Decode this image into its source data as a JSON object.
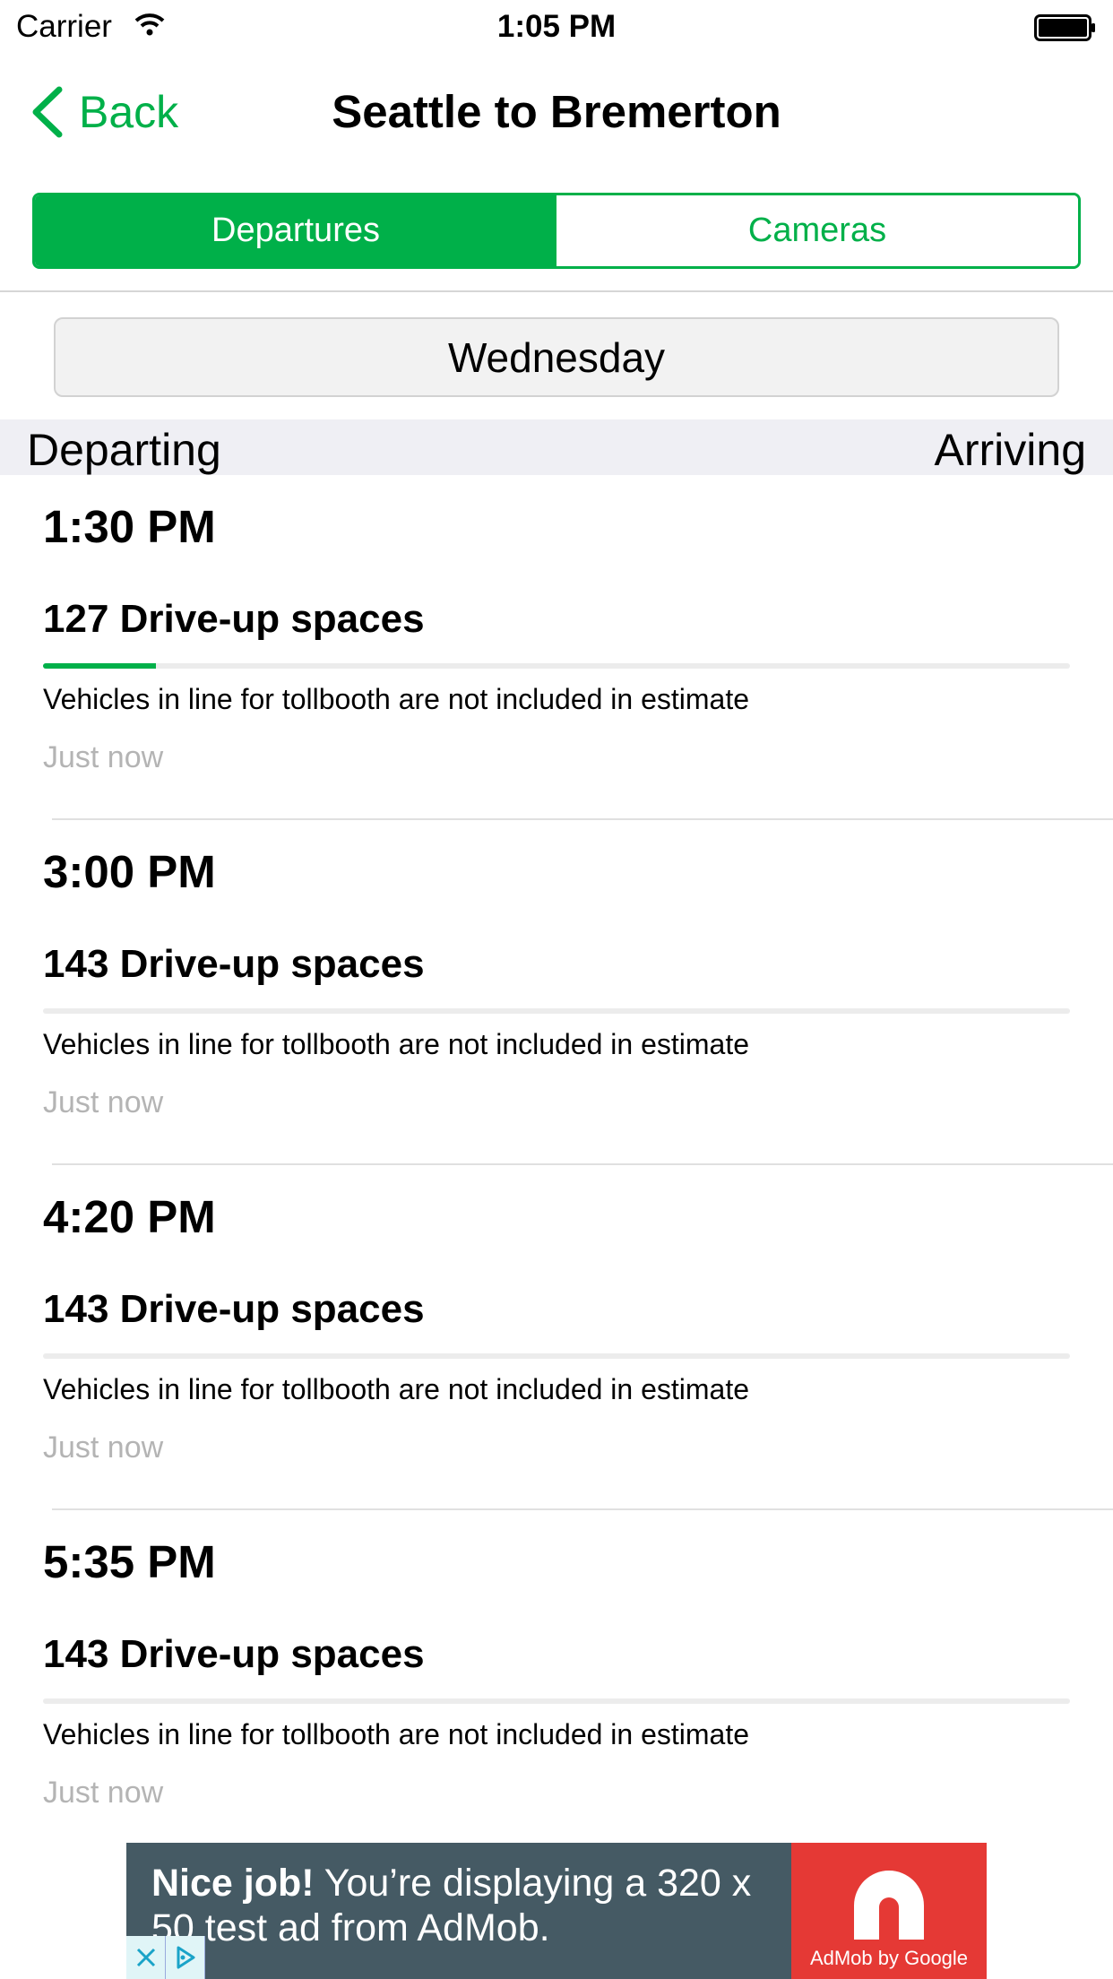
{
  "status_bar": {
    "carrier": "Carrier",
    "time": "1:05 PM"
  },
  "nav": {
    "back_label": "Back",
    "title": "Seattle to Bremerton"
  },
  "segments": {
    "departures": "Departures",
    "cameras": "Cameras"
  },
  "day": "Wednesday",
  "list_header": {
    "departing": "Departing",
    "arriving": "Arriving"
  },
  "sailings": [
    {
      "time": "1:30 PM",
      "spaces": "127 Drive-up spaces",
      "fill_percent": 11,
      "note": "Vehicles in line for tollbooth are not included in estimate",
      "updated": "Just now"
    },
    {
      "time": "3:00 PM",
      "spaces": "143 Drive-up spaces",
      "fill_percent": 0,
      "note": "Vehicles in line for tollbooth are not included in estimate",
      "updated": "Just now"
    },
    {
      "time": "4:20 PM",
      "spaces": "143 Drive-up spaces",
      "fill_percent": 0,
      "note": "Vehicles in line for tollbooth are not included in estimate",
      "updated": "Just now"
    },
    {
      "time": "5:35 PM",
      "spaces": "143 Drive-up spaces",
      "fill_percent": 0,
      "note": "Vehicles in line for tollbooth are not included in estimate",
      "updated": "Just now"
    }
  ],
  "ad": {
    "bold": "Nice job!",
    "text": " You’re displaying a 320 x 50 test ad from AdMob.",
    "brand": "AdMob by Google"
  },
  "colors": {
    "accent": "#00b049",
    "ad_bg": "#455a64",
    "ad_logo_bg": "#e53935"
  }
}
